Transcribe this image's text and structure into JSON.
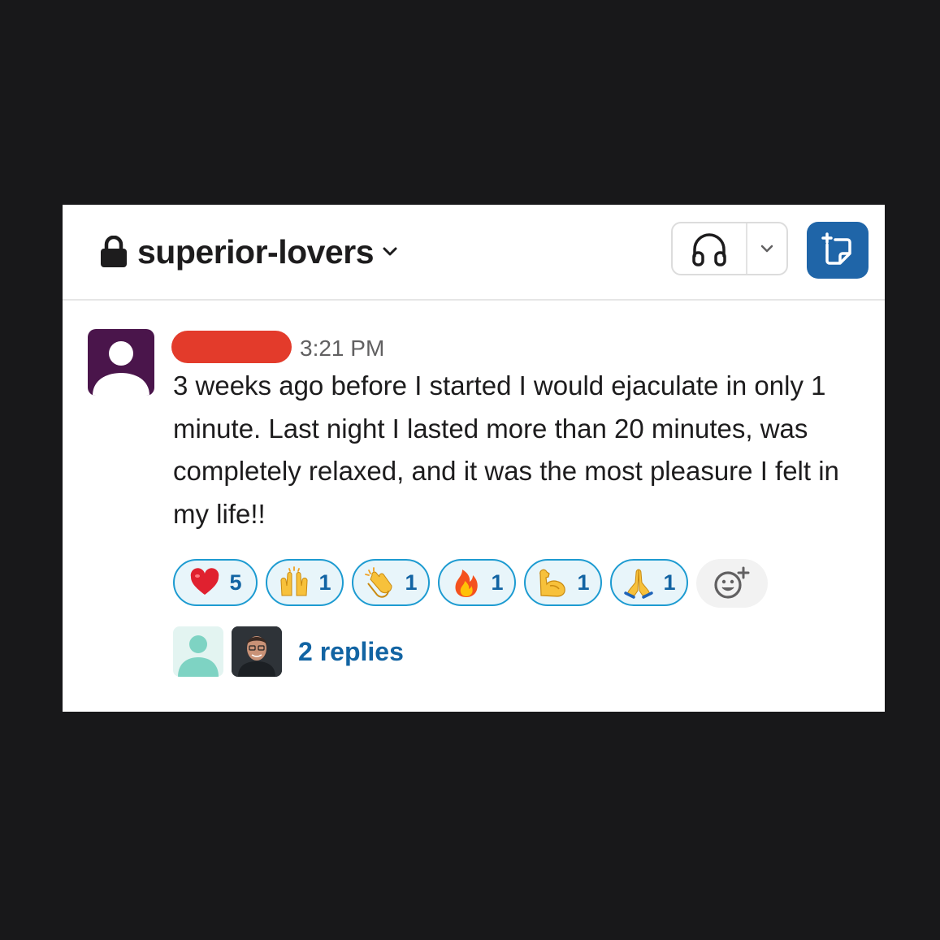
{
  "header": {
    "channel_name": "superior-lovers",
    "channel_icon": "lock-icon",
    "huddle_icon": "headphones-icon",
    "canvas_icon": "canvas-icon"
  },
  "message": {
    "timestamp": "3:21 PM",
    "author_redacted": true,
    "text": "3 weeks ago before I started I would ejaculate in only 1 minute. Last night I lasted more than 20 minutes, was completely relaxed, and it was the most pleasure I felt in my life!!"
  },
  "reactions": [
    {
      "emoji": "red-heart",
      "count": "5"
    },
    {
      "emoji": "raising-hands",
      "count": "1"
    },
    {
      "emoji": "clapping-hands",
      "count": "1"
    },
    {
      "emoji": "fire",
      "count": "1"
    },
    {
      "emoji": "flexed-biceps",
      "count": "1"
    },
    {
      "emoji": "folded-hands",
      "count": "1"
    }
  ],
  "thread": {
    "replies_label": "2 replies"
  },
  "colors": {
    "accent_blue": "#1264a3",
    "canvas_button": "#1f65a8",
    "avatar_purple": "#4a154b",
    "redaction": "#e33b2b",
    "reply_avatar_teal": "#7ed3c3"
  }
}
